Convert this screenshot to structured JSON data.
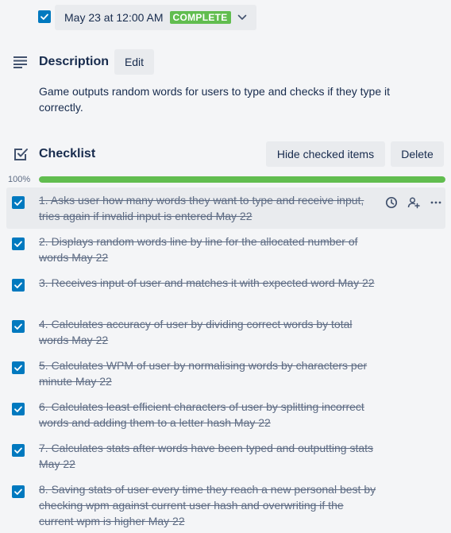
{
  "due": {
    "date_text": "May 23 at 12:00 AM",
    "status_badge": "COMPLETE",
    "badge_color": "#61bd4f",
    "checked": true
  },
  "description": {
    "title": "Description",
    "edit_label": "Edit",
    "text": "Game outputs random words for users to type and checks if they type it correctly."
  },
  "checklist": {
    "title": "Checklist",
    "hide_checked_label": "Hide checked items",
    "delete_label": "Delete",
    "progress_text": "100%",
    "progress": 1.0,
    "progress_color": "#61bd4f",
    "items": [
      {
        "text": "1. Asks user how many words they want to type and receive input, tries again if invalid input is entered May 22",
        "checked": true
      },
      {
        "text": "2. Displays random words line by line for the allocated number of words May 22",
        "checked": true
      },
      {
        "text": "3. Receives input of user and matches it with expected word May 22",
        "checked": true
      },
      {
        "text": "4. Calculates accuracy of user by dividing correct words by total words May 22",
        "checked": true
      },
      {
        "text": "5. Calculates WPM of user by normalising words by characters per minute May 22",
        "checked": true
      },
      {
        "text": "6. Calculates least efficient characters of user by splitting incorrect words and adding them to a letter hash May 22",
        "checked": true
      },
      {
        "text": "7. Calculates stats after words have been typed and outputting stats May 22",
        "checked": true
      },
      {
        "text": "8. Saving stats of user every time they reach a new personal best by checking wpm against current user hash and overwriting if the current wpm is higher May 22",
        "checked": true
      }
    ],
    "item_action_icons": [
      "clock-icon",
      "add-member-icon",
      "more-icon"
    ]
  }
}
